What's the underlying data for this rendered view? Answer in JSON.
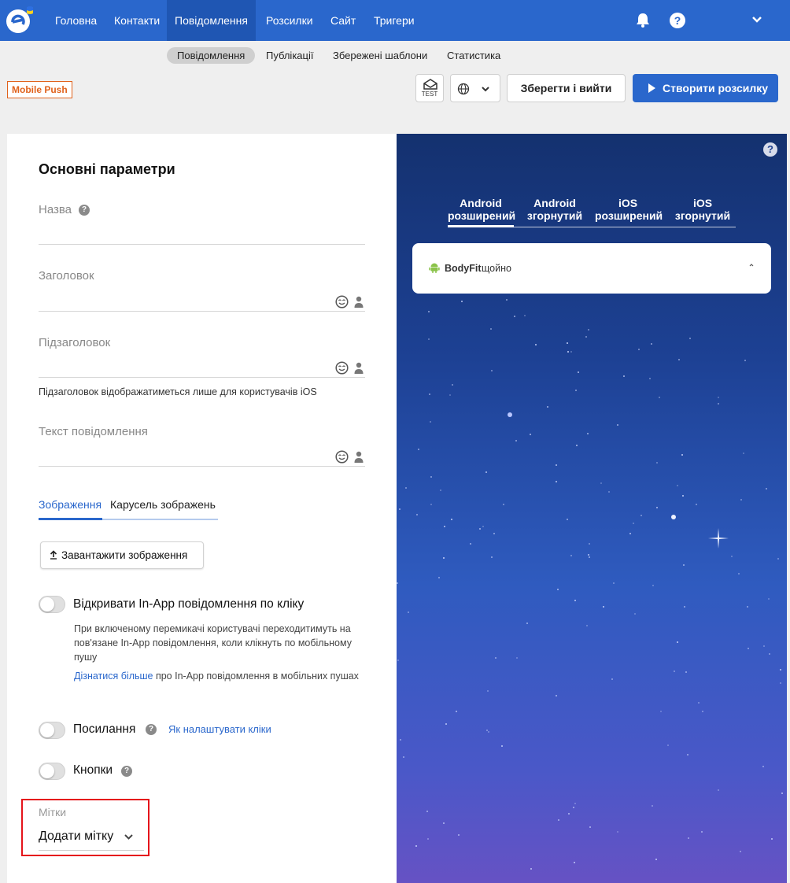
{
  "topnav": {
    "items": [
      "Головна",
      "Контакти",
      "Повідомлення",
      "Розсилки",
      "Сайт",
      "Тригери"
    ],
    "active_index": 2,
    "help_glyph": "?",
    "icons": [
      "logo-icon",
      "bell-icon",
      "help-icon",
      "chevron-down-icon"
    ]
  },
  "subnav": {
    "items": [
      "Повідомлення",
      "Публікації",
      "Збережені шаблони",
      "Статистика"
    ],
    "active_index": 0
  },
  "toolbar": {
    "badge": "Mobile Push",
    "test_label": "TEST",
    "save_label": "Зберегти і вийти",
    "create_label": "Створити розсилку"
  },
  "form": {
    "section_title": "Основні параметри",
    "name_label": "Назва",
    "title_label": "Заголовок",
    "subtitle_label": "Підзаголовок",
    "subtitle_hint": "Підзаголовок відображатиметься лише для користувачів iOS",
    "message_label": "Текст повідомлення",
    "tabs": [
      "Зображення",
      "Карусель зображень"
    ],
    "upload_label": "Завантажити зображення",
    "inapp_label": "Відкривати In-App повідомлення по кліку",
    "inapp_desc": "При включеному перемикачі користувачі переходитимуть на пов'язане In-App повідомлення, коли клікнуть по мобільному пушу",
    "inapp_link": "Дізнатися більше",
    "inapp_link_rest": " про In-App повідомлення в мобільних пушах",
    "links_label": "Посилання",
    "links_help_link": "Як налаштувати кліки",
    "buttons_label": "Кнопки",
    "tags_label": "Мітки",
    "tags_dropdown": "Додати мітку"
  },
  "preview": {
    "tabs": [
      {
        "line1": "Android",
        "line2": "розширений"
      },
      {
        "line1": "Android",
        "line2": "згорнутий"
      },
      {
        "line1": "iOS",
        "line2": "розширений"
      },
      {
        "line1": "iOS",
        "line2": "згорнутий"
      }
    ],
    "active_tab_index": 0,
    "notification": {
      "app": "BodyFit",
      "time": "щойно"
    }
  },
  "colors": {
    "brand_blue": "#2a67cc",
    "badge_orange": "#e0611b",
    "highlight_red": "#e5141b"
  }
}
